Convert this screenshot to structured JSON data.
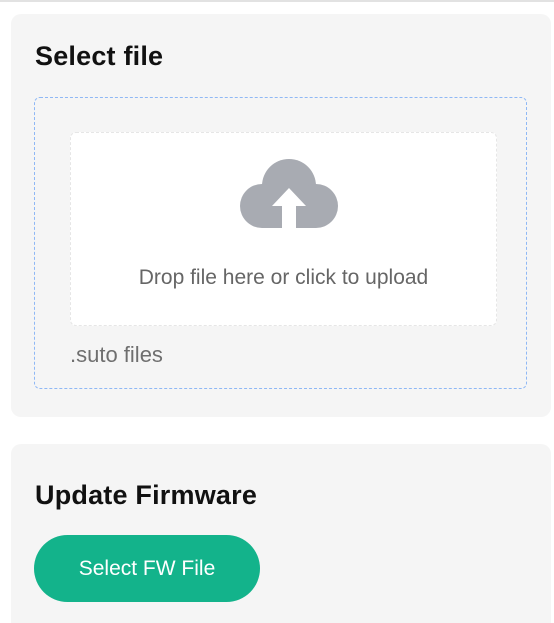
{
  "select_file": {
    "title": "Select file",
    "drop_text": "Drop file here or click to upload",
    "hint": ".suto files",
    "icon": "cloud-upload-icon"
  },
  "update_firmware": {
    "title": "Update Firmware",
    "button_label": "Select FW File"
  },
  "colors": {
    "accent": "#13b38b",
    "dropzone_border": "#8fb8f5",
    "icon": "#a8abb2",
    "card_bg": "#f5f5f5"
  }
}
